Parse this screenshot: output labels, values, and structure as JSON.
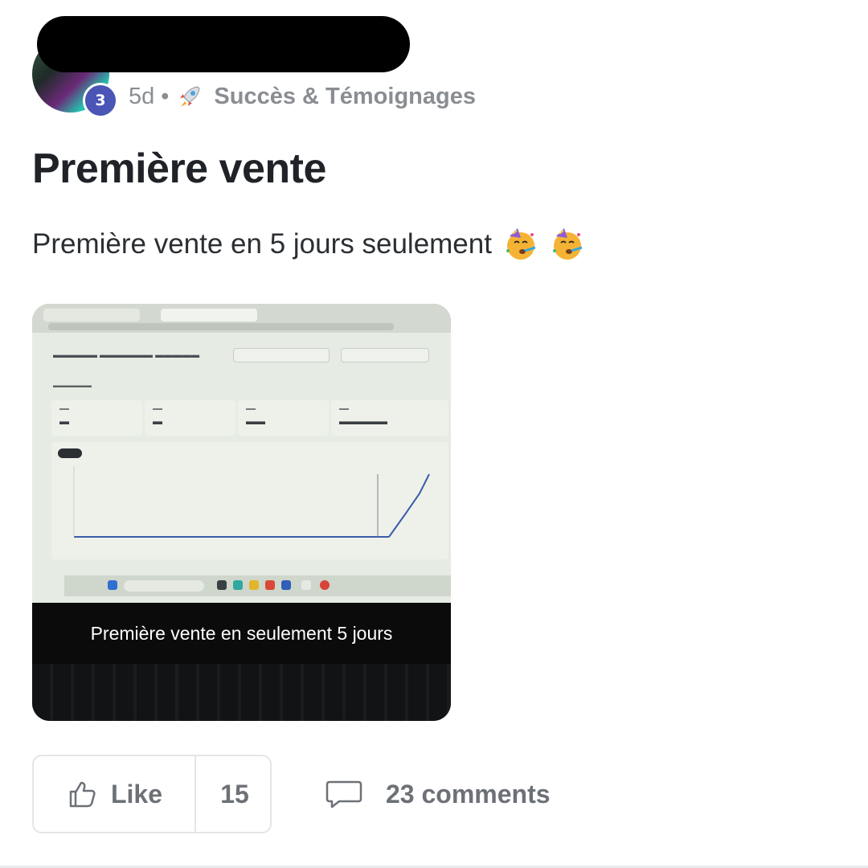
{
  "post": {
    "author_level": "3",
    "age": "5d",
    "separator": "•",
    "category_icon": "rocket-icon",
    "category": "Succès & Témoignages",
    "title": "Première vente",
    "body": "Première vente en 5 jours seulement",
    "body_emojis": [
      "partying-face-icon",
      "partying-face-icon"
    ]
  },
  "media": {
    "caption": "Première vente en seulement 5 jours"
  },
  "actions": {
    "like_label": "Like",
    "like_count": "15",
    "comments_label": "23 comments"
  },
  "colors": {
    "level_badge": "#4a55b5",
    "meta_text": "#8a8d92",
    "action_text": "#6d7177"
  }
}
